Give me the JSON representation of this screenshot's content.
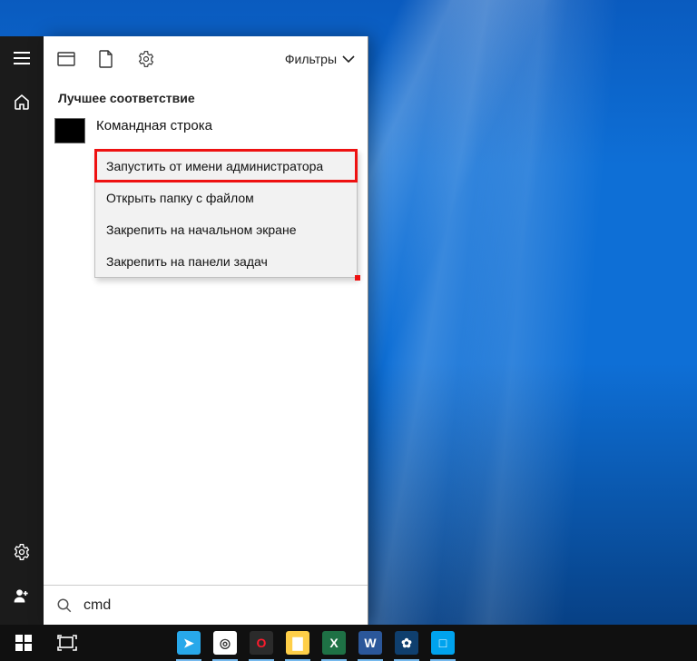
{
  "search": {
    "query": "cmd",
    "placeholder": ""
  },
  "panel": {
    "filters_label": "Фильтры",
    "section_label": "Лучшее соответствие",
    "result_title": "Командная строка",
    "context_menu": {
      "run_as_admin": "Запустить от имени администратора",
      "open_file_location": "Открыть папку с файлом",
      "pin_to_start": "Закрепить на начальном экране",
      "pin_to_taskbar": "Закрепить на панели задач"
    }
  },
  "colors": {
    "highlight": "#e11"
  },
  "taskbar_apps": [
    {
      "name": "telegram",
      "bg": "#28a8ea",
      "glyph": "➤"
    },
    {
      "name": "chrome",
      "bg": "#ffffff",
      "glyph": "◎"
    },
    {
      "name": "opera",
      "bg": "#2b2b2b",
      "glyph": "O",
      "fg": "#ff1b2d"
    },
    {
      "name": "file-explorer",
      "bg": "#ffcf48",
      "glyph": "▇"
    },
    {
      "name": "excel",
      "bg": "#1e7145",
      "glyph": "X"
    },
    {
      "name": "word",
      "bg": "#2b579a",
      "glyph": "W"
    },
    {
      "name": "paintnet",
      "bg": "#0f3f6e",
      "glyph": "✿"
    },
    {
      "name": "another",
      "bg": "#00a3ee",
      "glyph": "□"
    }
  ]
}
